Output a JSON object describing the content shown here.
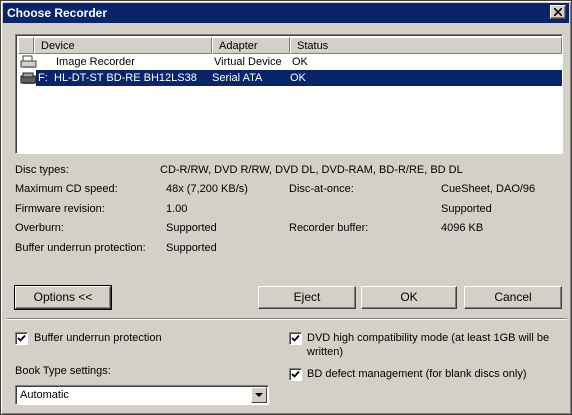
{
  "window": {
    "title": "Choose Recorder"
  },
  "devices": {
    "columns": [
      "Device",
      "Adapter",
      "Status"
    ],
    "rows": [
      {
        "prefix": "",
        "device": "Image Recorder",
        "adapter": "Virtual Device",
        "status": "OK",
        "selected": false
      },
      {
        "prefix": "F:",
        "device": "HL-DT-ST BD-RE  BH12LS38",
        "adapter": "Serial ATA",
        "status": "OK",
        "selected": true
      }
    ]
  },
  "info": {
    "disc_types_label": "Disc types:",
    "disc_types_value": "CD-R/RW, DVD R/RW, DVD DL, DVD-RAM, BD-R/RE, BD DL",
    "max_cd_speed_label": "Maximum CD speed:",
    "max_cd_speed_value": "48x (7,200 KB/s)",
    "disc_at_once_label": "Disc-at-once:",
    "disc_at_once_value": "CueSheet, DAO/96",
    "firmware_label": "Firmware revision:",
    "firmware_value": "1.00",
    "dao_supported_value": "Supported",
    "overburn_label": "Overburn:",
    "overburn_value": "Supported",
    "recorder_buffer_label": "Recorder buffer:",
    "recorder_buffer_value": "4096 KB",
    "buffer_underrun_label": "Buffer underrun protection:",
    "buffer_underrun_value": "Supported"
  },
  "buttons": {
    "options": "Options <<",
    "eject": "Eject",
    "ok": "OK",
    "cancel": "Cancel"
  },
  "options": {
    "buffer_underrun_protection": {
      "label": "Buffer underrun protection",
      "checked": true
    },
    "dvd_high_compat": {
      "label": "DVD high compatibility mode (at least 1GB will be written)",
      "label_line1": "DVD high compatibility mode (at least 1GB will be",
      "label_line2": "written)",
      "checked": true
    },
    "bd_defect_mgmt": {
      "label": "BD defect management (for blank discs only)",
      "checked": true
    },
    "book_type_label": "Book Type settings:",
    "book_type_value": "Automatic"
  }
}
